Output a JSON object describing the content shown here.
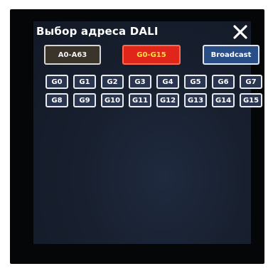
{
  "title": "Выбор адреса DALI",
  "close_icon": "close-icon",
  "modes": {
    "a_range": "A0-A63",
    "g_range": "G0-G15",
    "broadcast": "Broadcast"
  },
  "colors": {
    "selected_bg": "#e0261b",
    "selected_text": "#ffe33a",
    "broadcast_bg": "#2a4e86",
    "group_bg": "#2a3550"
  },
  "groups": [
    "G0",
    "G1",
    "G2",
    "G3",
    "G4",
    "G5",
    "G6",
    "G7",
    "G8",
    "G9",
    "G10",
    "G11",
    "G12",
    "G13",
    "G14",
    "G15"
  ]
}
